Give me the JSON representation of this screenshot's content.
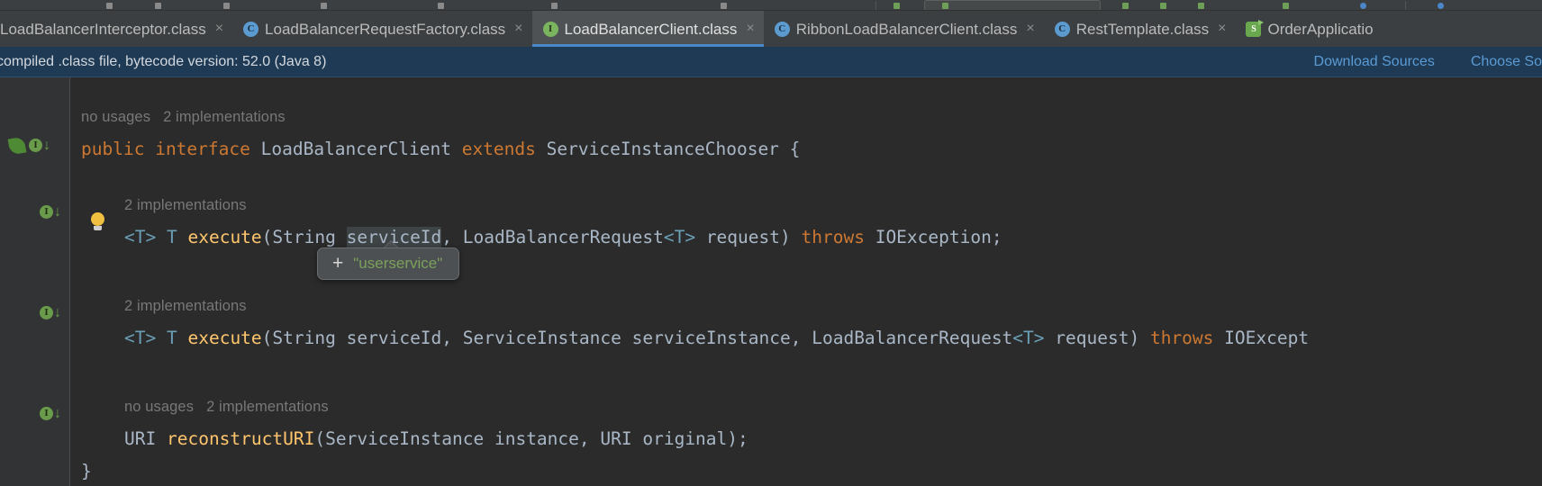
{
  "toolbar": {
    "icons": [
      "run-icon",
      "debug-icon",
      "stop-icon",
      "build-icon",
      "sync-icon",
      "search-icon",
      "settings-icon",
      "git-icon"
    ],
    "run_config_placeholder": ""
  },
  "tabs": [
    {
      "label": "LoadBalancerInterceptor.class",
      "icon": "class-icon",
      "active": false,
      "close": "×"
    },
    {
      "label": "LoadBalancerRequestFactory.class",
      "icon": "class-icon",
      "active": false,
      "close": "×"
    },
    {
      "label": "LoadBalancerClient.class",
      "icon": "interface-icon",
      "active": true,
      "close": "×"
    },
    {
      "label": "RibbonLoadBalancerClient.class",
      "icon": "class-icon",
      "active": false,
      "close": "×"
    },
    {
      "label": "RestTemplate.class",
      "icon": "class-icon",
      "active": false,
      "close": "×"
    },
    {
      "label": "OrderApplicatio",
      "icon": "spring-boot-icon",
      "active": false,
      "close": ""
    }
  ],
  "banner": {
    "message": "compiled .class file, bytecode version: 52.0 (Java 8)",
    "download_sources": "Download Sources",
    "choose_sources": "Choose So"
  },
  "code": {
    "hint_class": "no usages   2 implementations",
    "hint_method1": "2 implementations",
    "hint_method2": "2 implementations",
    "hint_method3": "no usages   2 implementations",
    "declaration": {
      "kw_public": "public",
      "kw_interface": "interface",
      "name": "LoadBalancerClient",
      "kw_extends": "extends",
      "super": "ServiceInstanceChooser",
      "brace": "{"
    },
    "method1": {
      "generic": "<T>",
      "ret": "T",
      "name": "execute",
      "open": "(",
      "p1type": "String",
      "p1name": "serviceId",
      "comma1": ", ",
      "p2type": "LoadBalancerRequest",
      "p2generic": "<T>",
      "p2name": " request",
      "close": ")",
      "kw_throws": "throws",
      "exception": "IOException;"
    },
    "method2": {
      "generic": "<T>",
      "ret": "T",
      "name": "execute",
      "open": "(",
      "p1type": "String",
      "p1name": "serviceId",
      "comma1": ", ",
      "p2type": "ServiceInstance",
      "p2name": "serviceInstance",
      "comma2": ", ",
      "p3type": "LoadBalancerRequest",
      "p3generic": "<T>",
      "p3name": " request",
      "close": ")",
      "kw_throws": "throws",
      "exception": "IOExcept"
    },
    "method3": {
      "ret": "URI",
      "name": "reconstructURI",
      "open": "(",
      "p1type": "ServiceInstance",
      "p1name": "instance",
      "comma1": ", ",
      "p2type": "URI",
      "p2name": "original",
      "close": ");"
    },
    "closing_brace": "}"
  },
  "popup": {
    "plus": "+",
    "value": "\"userservice\""
  },
  "colors": {
    "editor_bg": "#2b2b2b",
    "gutter_bg": "#313335",
    "tab_active_bg": "#4e5254",
    "banner_bg": "#1e3a54",
    "accent_blue": "#4a88c7",
    "link_blue": "#5b9bd5",
    "keyword_orange": "#cc7832",
    "method_yellow": "#ffc66d",
    "string_green": "#7ba05b",
    "hint_gray": "#787878"
  }
}
